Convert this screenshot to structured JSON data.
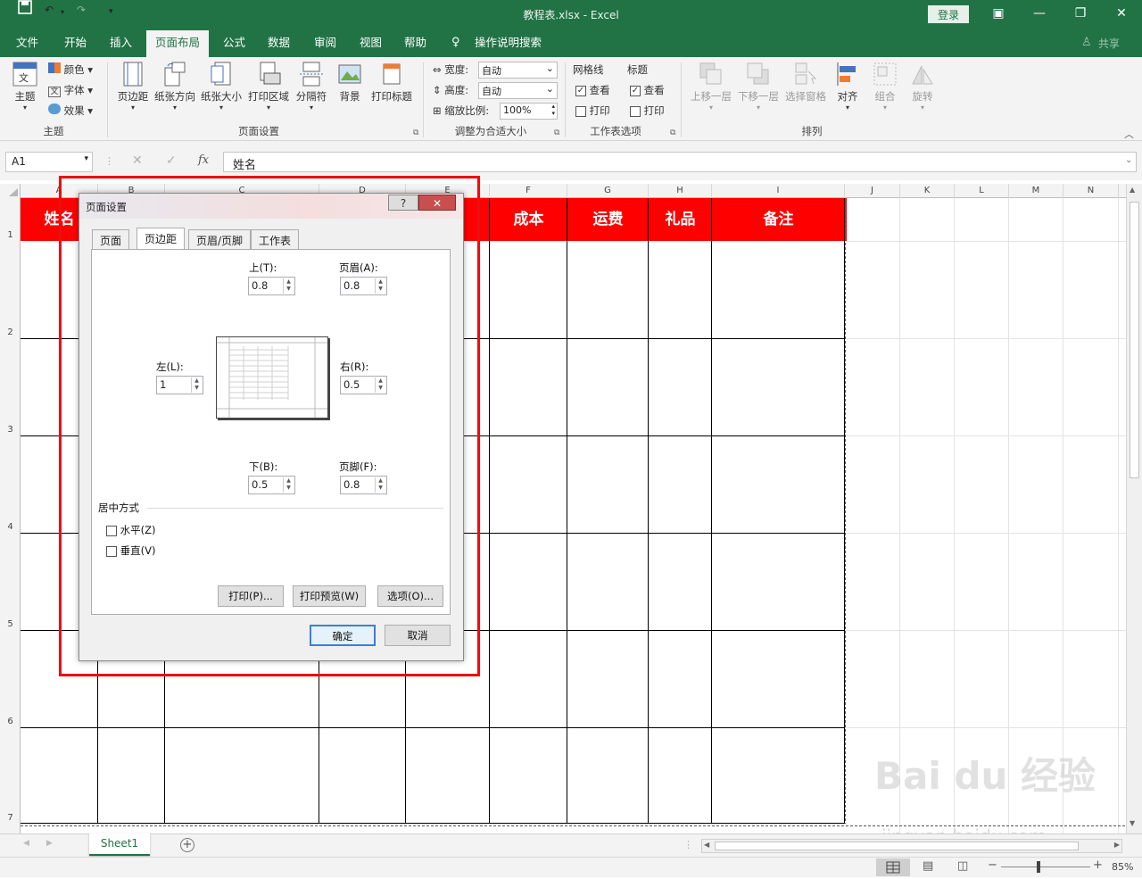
{
  "window": {
    "title": "教程表.xlsx  -  Excel",
    "login": "登录"
  },
  "tabs": [
    "文件",
    "开始",
    "插入",
    "页面布局",
    "公式",
    "数据",
    "审阅",
    "视图",
    "帮助",
    "操作说明搜索"
  ],
  "share": "共享",
  "ribbon": {
    "theme": {
      "themes": "主题",
      "colors": "颜色",
      "fonts": "字体",
      "effects": "效果",
      "label": "主题"
    },
    "page_setup": {
      "margins": "页边距",
      "orientation": "纸张方向",
      "size": "纸张大小",
      "print_area": "打印区域",
      "breaks": "分隔符",
      "background": "背景",
      "print_titles": "打印标题",
      "label": "页面设置"
    },
    "scale": {
      "width_label": "宽度:",
      "width_value": "自动",
      "height_label": "高度:",
      "height_value": "自动",
      "scale_label": "缩放比例:",
      "scale_value": "100%",
      "label": "调整为合适大小"
    },
    "sheet_options": {
      "gridlines": "网格线",
      "headings": "标题",
      "view": "查看",
      "print": "打印",
      "label": "工作表选项"
    },
    "arrange": {
      "bring_forward": "上移一层",
      "send_backward": "下移一层",
      "selection_pane": "选择窗格",
      "align": "对齐",
      "group": "组合",
      "rotate": "旋转",
      "label": "排列"
    }
  },
  "formula_bar": {
    "name_box": "A1",
    "value": "姓名",
    "fx": "fx"
  },
  "columns": [
    "A",
    "B",
    "C",
    "D",
    "E",
    "F",
    "G",
    "H",
    "I",
    "J",
    "K",
    "L",
    "M",
    "N"
  ],
  "rows": [
    "1",
    "2",
    "3",
    "4",
    "5",
    "6",
    "7"
  ],
  "header_cells": {
    "A": "姓名",
    "F": "成本",
    "G": "运费",
    "H": "礼品",
    "I": "备注"
  },
  "dialog": {
    "title": "页面设置",
    "help": "?",
    "close": "✕",
    "tabs": [
      "页面",
      "页边距",
      "页眉/页脚",
      "工作表"
    ],
    "top_label": "上(T):",
    "top_value": "0.8",
    "header_label": "页眉(A):",
    "header_value": "0.8",
    "left_label": "左(L):",
    "left_value": "1",
    "right_label": "右(R):",
    "right_value": "0.5",
    "bottom_label": "下(B):",
    "bottom_value": "0.5",
    "footer_label": "页脚(F):",
    "footer_value": "0.8",
    "center_section": "居中方式",
    "horizontal": "水平(Z)",
    "vertical": "垂直(V)",
    "print_btn": "打印(P)...",
    "preview_btn": "打印预览(W)",
    "options_btn": "选项(O)...",
    "ok": "确定",
    "cancel": "取消"
  },
  "sheet_tab": "Sheet1",
  "zoom": "85%",
  "watermark": {
    "main": "Bai du 经验",
    "url": "jingyan.baidu.com"
  }
}
